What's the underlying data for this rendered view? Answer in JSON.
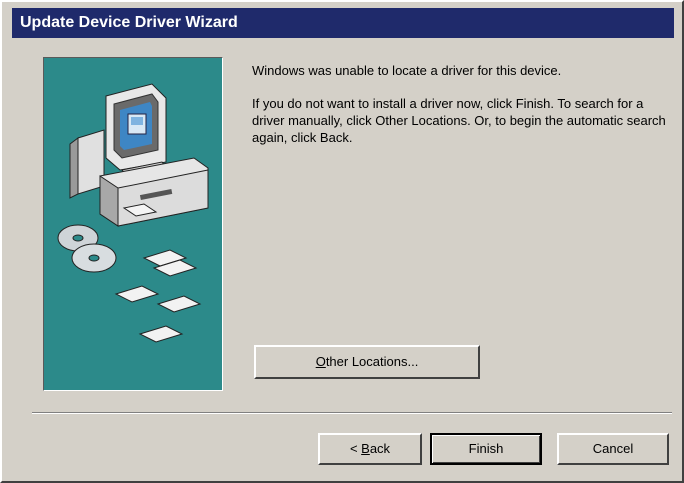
{
  "window": {
    "title": "Update Device Driver Wizard"
  },
  "message": {
    "line1": "Windows was unable to locate a driver for this device.",
    "line2": "If you do not want to install a driver now, click Finish. To search for a driver manually, click Other Locations. Or, to begin the automatic search again, click Back."
  },
  "buttons": {
    "other_locations": {
      "mnemonic": "O",
      "rest": "ther Locations..."
    },
    "back": {
      "prefix": "< ",
      "mnemonic": "B",
      "rest": "ack"
    },
    "finish": "Finish",
    "cancel": "Cancel"
  },
  "colors": {
    "titlebar": "#1f2a6b",
    "art_background": "#2c8a8a",
    "dialog": "#d4d0c8"
  },
  "art": {
    "icons": [
      "computer-illustration",
      "cd-discs-icon",
      "floppy-disks-icon"
    ]
  }
}
